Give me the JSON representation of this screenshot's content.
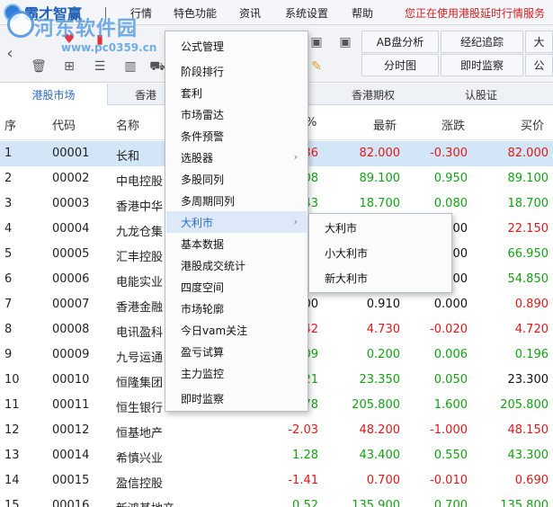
{
  "menubar": {
    "app_title": "霸才智赢",
    "items": [
      "行情",
      "特色功能",
      "资讯",
      "系统设置",
      "帮助"
    ],
    "delay_notice": "您正在使用港股延时行情服务"
  },
  "watermark": {
    "text": "河东软件园",
    "url": "www.pc0359.cn"
  },
  "toolbar": {
    "buttons": [
      "AB盘分析",
      "经纪追踪",
      "大",
      "分时图",
      "即时监察",
      "公"
    ]
  },
  "tabs": [
    "港股市场",
    "香港",
    "香港期权",
    "认股证"
  ],
  "table": {
    "headers": {
      "seq": "序",
      "code": "代码",
      "name": "名称",
      "pct": "%",
      "last": "最新",
      "change": "涨跌",
      "bid": "买价"
    },
    "rows": [
      {
        "seq": "1",
        "code": "00001",
        "name": "长和",
        "pct": "36",
        "last": "82.000",
        "change": "-0.300",
        "bid": "82.000",
        "pc": "red",
        "lc": "red",
        "cc": "red",
        "bc": "red"
      },
      {
        "seq": "2",
        "code": "00002",
        "name": "中电控股",
        "pct": "08",
        "last": "89.100",
        "change": "0.950",
        "bid": "89.100",
        "pc": "green",
        "lc": "green",
        "cc": "green",
        "bc": "green"
      },
      {
        "seq": "3",
        "code": "00003",
        "name": "香港中华",
        "pct": "43",
        "last": "18.700",
        "change": "0.080",
        "bid": "18.700",
        "pc": "green",
        "lc": "green",
        "cc": "green",
        "bc": "green"
      },
      {
        "seq": "4",
        "code": "00004",
        "name": "九龙仓集",
        "pct": "",
        "last": "",
        "change": "00",
        "bid": "22.150",
        "pc": "black",
        "lc": "black",
        "cc": "black",
        "bc": "red"
      },
      {
        "seq": "5",
        "code": "00005",
        "name": "汇丰控股",
        "pct": "",
        "last": "",
        "change": "00",
        "bid": "66.950",
        "pc": "black",
        "lc": "black",
        "cc": "black",
        "bc": "green"
      },
      {
        "seq": "6",
        "code": "00006",
        "name": "电能实业",
        "pct": "",
        "last": "",
        "change": "00",
        "bid": "54.850",
        "pc": "black",
        "lc": "black",
        "cc": "black",
        "bc": "green"
      },
      {
        "seq": "7",
        "code": "00007",
        "name": "香港金融",
        "pct": "00",
        "last": "0.910",
        "change": "0.000",
        "bid": "0.890",
        "pc": "black",
        "lc": "black",
        "cc": "black",
        "bc": "red"
      },
      {
        "seq": "8",
        "code": "00008",
        "name": "电讯盈科",
        "pct": "42",
        "last": "4.730",
        "change": "-0.020",
        "bid": "4.720",
        "pc": "red",
        "lc": "red",
        "cc": "red",
        "bc": "red"
      },
      {
        "seq": "9",
        "code": "00009",
        "name": "九号运通",
        "pct": "09",
        "last": "0.200",
        "change": "0.006",
        "bid": "0.196",
        "pc": "green",
        "lc": "green",
        "cc": "green",
        "bc": "green"
      },
      {
        "seq": "10",
        "code": "00010",
        "name": "恒隆集团",
        "pct": "21",
        "last": "23.350",
        "change": "0.050",
        "bid": "23.300",
        "pc": "green",
        "lc": "green",
        "cc": "green",
        "bc": "black"
      },
      {
        "seq": "11",
        "code": "00011",
        "name": "恒生银行",
        "pct": "78",
        "last": "205.800",
        "change": "1.600",
        "bid": "205.800",
        "pc": "green",
        "lc": "green",
        "cc": "green",
        "bc": "green"
      },
      {
        "seq": "12",
        "code": "00012",
        "name": "恒基地产",
        "pct": "-2.03",
        "last": "48.200",
        "change": "-1.000",
        "bid": "48.150",
        "pc": "red",
        "lc": "red",
        "cc": "red",
        "bc": "red"
      },
      {
        "seq": "13",
        "code": "00014",
        "name": "希慎兴业",
        "pct": "1.28",
        "last": "43.400",
        "change": "0.550",
        "bid": "43.300",
        "pc": "green",
        "lc": "green",
        "cc": "green",
        "bc": "green"
      },
      {
        "seq": "14",
        "code": "00015",
        "name": "盈信控股",
        "pct": "-1.41",
        "last": "0.700",
        "change": "-0.010",
        "bid": "0.690",
        "pc": "red",
        "lc": "red",
        "cc": "red",
        "bc": "red"
      },
      {
        "seq": "15",
        "code": "00016",
        "name": "新鸿基地产",
        "pct": "0.52",
        "last": "135.900",
        "change": "0.700",
        "bid": "135.800",
        "pc": "green",
        "lc": "green",
        "cc": "green",
        "bc": "green"
      }
    ]
  },
  "context_menu": {
    "items": [
      "公式管理",
      "阶段排行",
      "套利",
      "市场雷达",
      "条件预警",
      "选股器",
      "多股同列",
      "多周期同列",
      "大利市",
      "基本数据",
      "港股成交统计",
      "四度空间",
      "市场轮廓",
      "今日vam关注",
      "盈亏试算",
      "主力监控",
      "即时监察"
    ],
    "highlighted": "大利市",
    "submenu": [
      "大利市",
      "小大利市",
      "新大利市"
    ]
  },
  "colors": {
    "up": "#14a014",
    "down": "#e11818",
    "accent": "#2b6cc4",
    "selected_row": "#d3e6f8"
  }
}
